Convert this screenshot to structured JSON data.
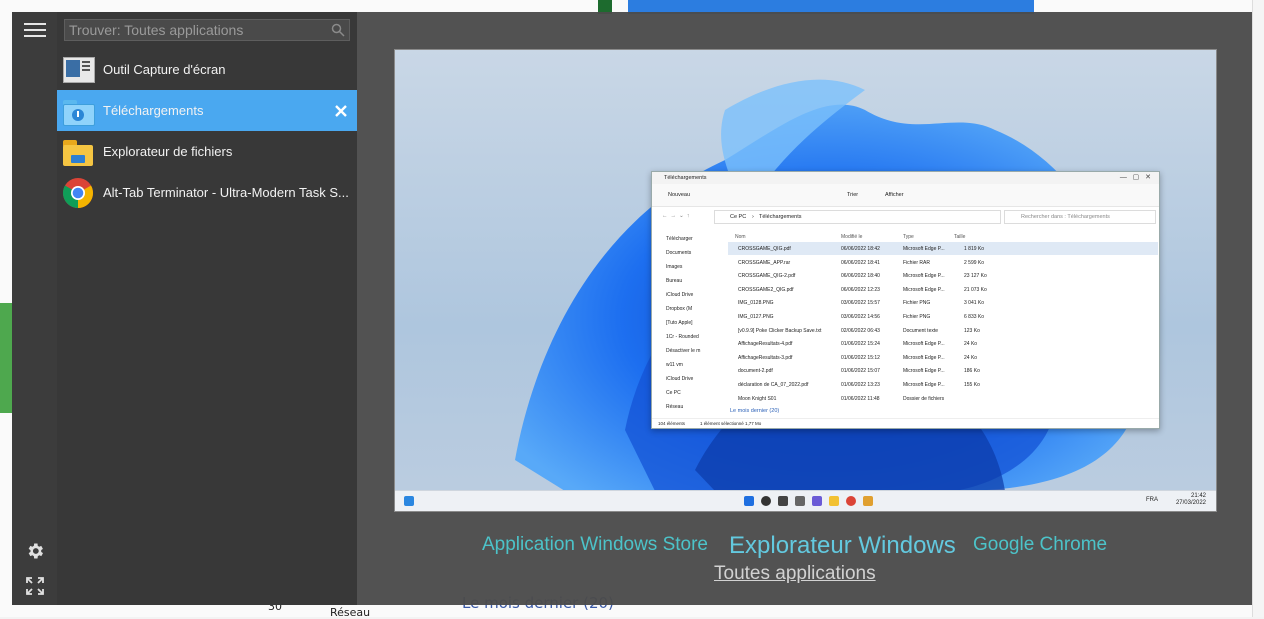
{
  "search": {
    "placeholder": "Trouver: Toutes applications"
  },
  "apps": [
    {
      "label": "Outil Capture d'écran",
      "icon": "snipping-tool-icon",
      "selected": false
    },
    {
      "label": "Téléchargements",
      "icon": "downloads-folder-icon",
      "selected": true
    },
    {
      "label": "Explorateur de fichiers",
      "icon": "file-explorer-icon",
      "selected": false
    },
    {
      "label": "Alt-Tab Terminator - Ultra-Modern Task S...",
      "icon": "chrome-icon",
      "selected": false
    }
  ],
  "rail": {
    "menu_icon": "hamburger-icon",
    "settings_icon": "gear-icon",
    "fullscreen_icon": "expand-icon"
  },
  "categories": {
    "store": "Application Windows Store",
    "explorer": "Explorateur Windows",
    "chrome": "Google Chrome",
    "all": "Toutes applications"
  },
  "preview": {
    "window_title": "Téléchargements",
    "toolbar_new": "Nouveau",
    "toolbar_sort": "Trier",
    "toolbar_view": "Afficher",
    "breadcrumb_root": "Ce PC",
    "breadcrumb_folder": "Téléchargements",
    "search_placeholder": "Rechercher dans : Téléchargements",
    "columns": [
      "Nom",
      "Modifié le",
      "Type",
      "Taille"
    ],
    "sidebar": [
      "Télécharger",
      "Documents",
      "Images",
      "Bureau",
      "iCloud Drive",
      "Dropbox (M",
      "[Tuto Apple]",
      "1Cr - Rounded",
      "Désactiver le m",
      "w11 vm",
      "iCloud Drive",
      "Ce PC",
      "Réseau"
    ],
    "files": [
      {
        "name": "CROSSGAME_QIG.pdf",
        "date": "06/06/2022 18:42",
        "type": "Microsoft Edge P...",
        "size": "1 819 Ko"
      },
      {
        "name": "CROSSGAME_APP.rar",
        "date": "06/06/2022 18:41",
        "type": "Fichier RAR",
        "size": "2 599 Ko"
      },
      {
        "name": "CROSSGAME_QIG-2.pdf",
        "date": "06/06/2022 18:40",
        "type": "Microsoft Edge P...",
        "size": "23 127 Ko"
      },
      {
        "name": "CROSSGAME2_QIG.pdf",
        "date": "06/06/2022 12:23",
        "type": "Microsoft Edge P...",
        "size": "21 073 Ko"
      },
      {
        "name": "IMG_0128.PNG",
        "date": "03/06/2022 15:57",
        "type": "Fichier PNG",
        "size": "3 041 Ko"
      },
      {
        "name": "IMG_0127.PNG",
        "date": "03/06/2022 14:56",
        "type": "Fichier PNG",
        "size": "6 833 Ko"
      },
      {
        "name": "[v0.9.9] Poke Clicker Backup Save.txt",
        "date": "02/06/2022 06:43",
        "type": "Document texte",
        "size": "123 Ko"
      },
      {
        "name": "AffichageResultats-4.pdf",
        "date": "01/06/2022 15:24",
        "type": "Microsoft Edge P...",
        "size": "24 Ko"
      },
      {
        "name": "AffichageResultats-3.pdf",
        "date": "01/06/2022 15:12",
        "type": "Microsoft Edge P...",
        "size": "24 Ko"
      },
      {
        "name": "document-2.pdf",
        "date": "01/06/2022 15:07",
        "type": "Microsoft Edge P...",
        "size": "186 Ko"
      },
      {
        "name": "déclaration de CA_07_2022.pdf",
        "date": "01/06/2022 13:23",
        "type": "Microsoft Edge P...",
        "size": "155 Ko"
      },
      {
        "name": "Moon Knight S01",
        "date": "01/06/2022 11:48",
        "type": "Dossier de fichiers",
        "size": ""
      }
    ],
    "group_header": "Le mois dernier (20)",
    "status_count": "104 éléments",
    "status_selected": "1 élément sélectionné 1,77 Mo",
    "clock_time": "21:42",
    "clock_date": "27/03/2022",
    "lang": "FRA"
  },
  "background": {
    "footer_text": "Le mois dernier (20)",
    "network_text": "Réseau",
    "number_text": "30"
  },
  "colors": {
    "accent": "#4aa8f0",
    "category": "#4cc3c9"
  }
}
